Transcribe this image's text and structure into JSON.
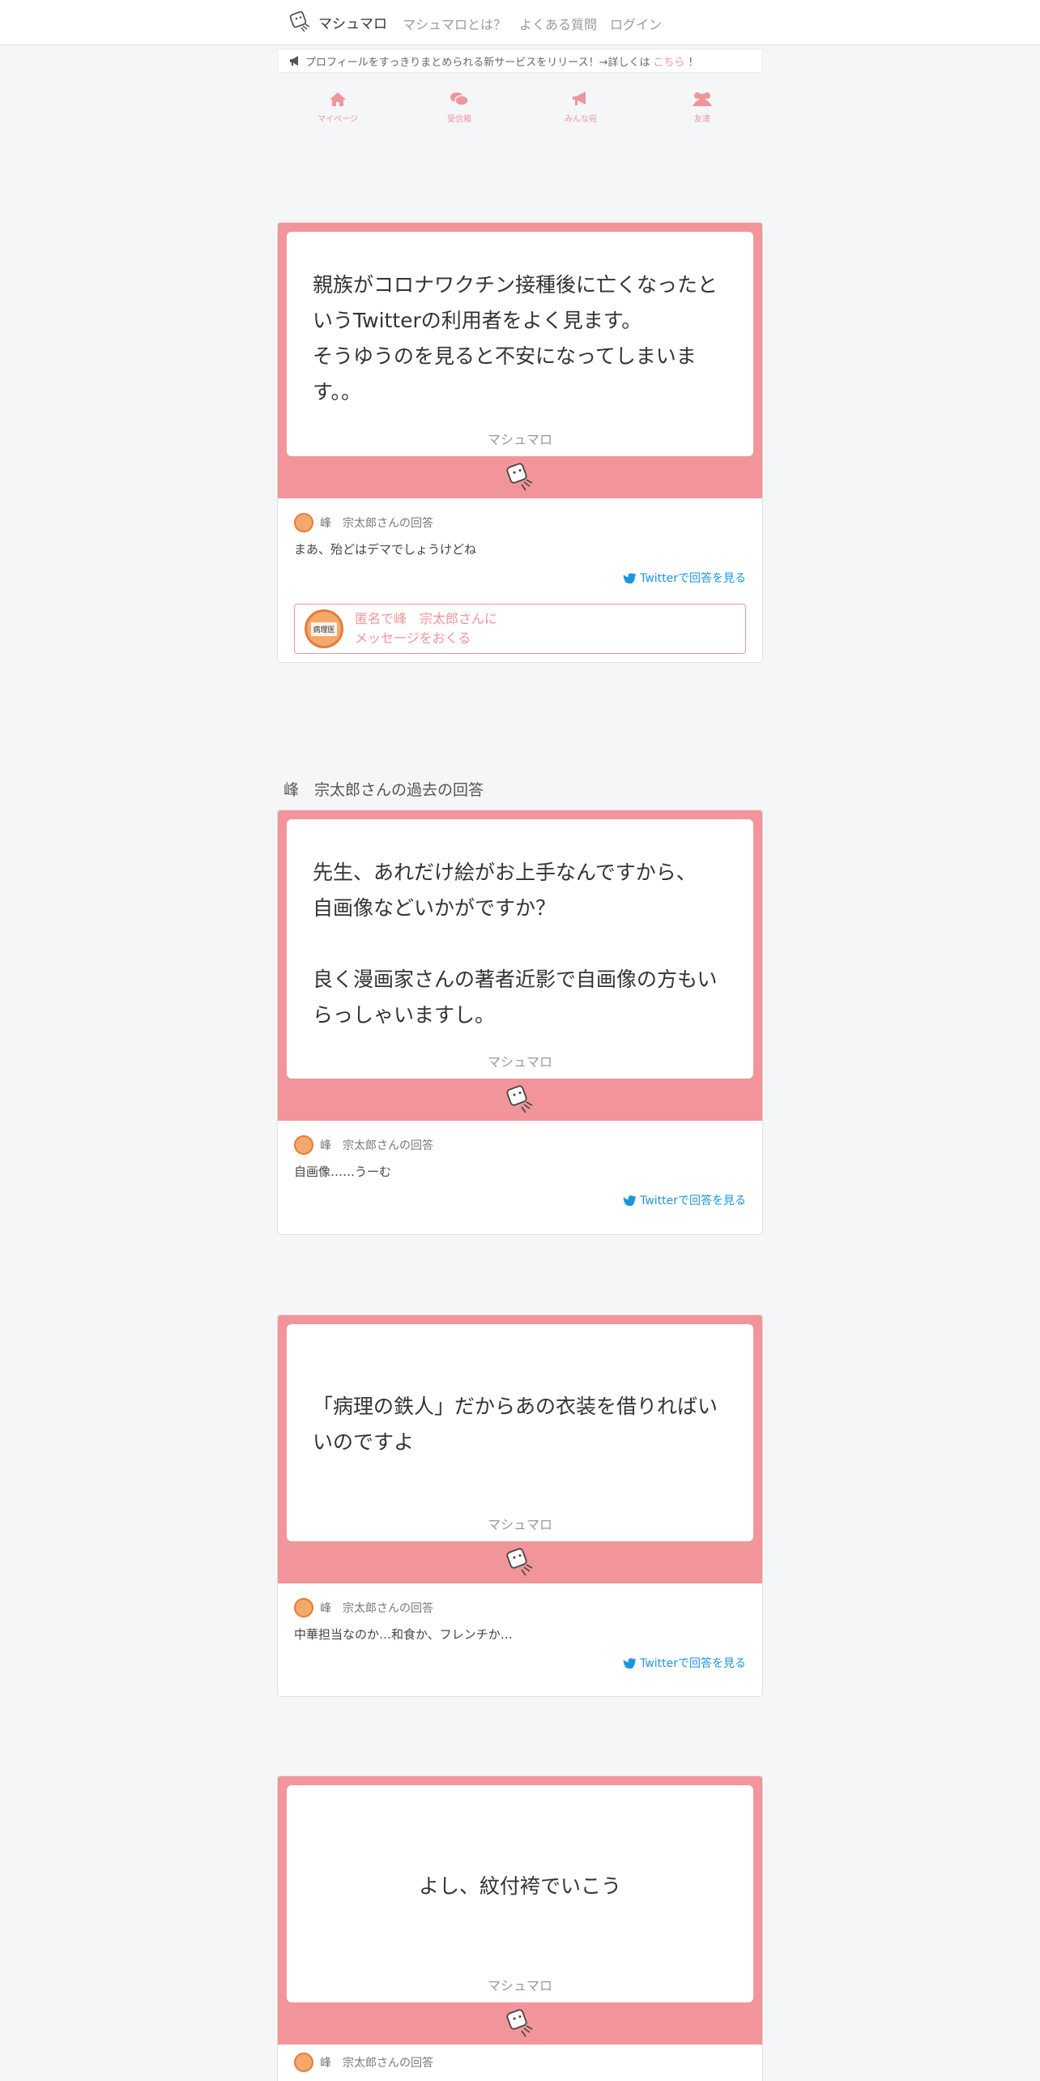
{
  "header": {
    "brand": "マシュマロ",
    "nav": [
      "マシュマロとは？",
      "よくある質問",
      "ログイン"
    ]
  },
  "announcement": {
    "text": "プロフィールをすっきりまとめられる新サービスをリリース！→詳しくは",
    "link": "こちら",
    "suffix": "！"
  },
  "tabs": [
    {
      "label": "マイページ",
      "icon": "home-icon"
    },
    {
      "label": "受信箱",
      "icon": "comments-icon"
    },
    {
      "label": "みんな宛",
      "icon": "megaphone-icon"
    },
    {
      "label": "友達",
      "icon": "users-icon"
    }
  ],
  "colors": {
    "accent": "#f2959a",
    "twitter": "#1b95e0",
    "link": "#f0959b"
  },
  "main": {
    "question": "親族がコロナワクチン接種後に亡くなったというTwitterの利用者をよく見ます。\nそうゆうのを見ると不安になってしまいます。。",
    "footer": "マシュマロ",
    "answer_head": "峰　宗太郎さんの回答",
    "answer_text": "まあ、殆どはデマでしょうけどね",
    "twitter_link": "Twitterで回答を見る",
    "send_line1": "匿名で峰　宗太郎さんに",
    "send_line2": "メッセージをおくる",
    "avatar_text": "病理医"
  },
  "past_title": "峰　宗太郎さんの過去の回答",
  "past": [
    {
      "question": "先生、あれだけ絵がお上手なんですから、\n自画像などいかがですか？\n\n良く漫画家さんの著者近影で自画像の方もいらっしゃいますし。",
      "footer": "マシュマロ",
      "answer_head": "峰　宗太郎さんの回答",
      "answer_text": "自画像……うーむ",
      "twitter_link": "Twitterで回答を見る"
    },
    {
      "question": "「病理の鉄人」だからあの衣装を借りればいいのですよ",
      "footer": "マシュマロ",
      "answer_head": "峰　宗太郎さんの回答",
      "answer_text": "中華担当なのか…和食か、フレンチか…",
      "twitter_link": "Twitterで回答を見る"
    },
    {
      "question": "よし、紋付袴でいこう",
      "footer": "マシュマロ",
      "answer_head": "峰　宗太郎さんの回答"
    }
  ]
}
